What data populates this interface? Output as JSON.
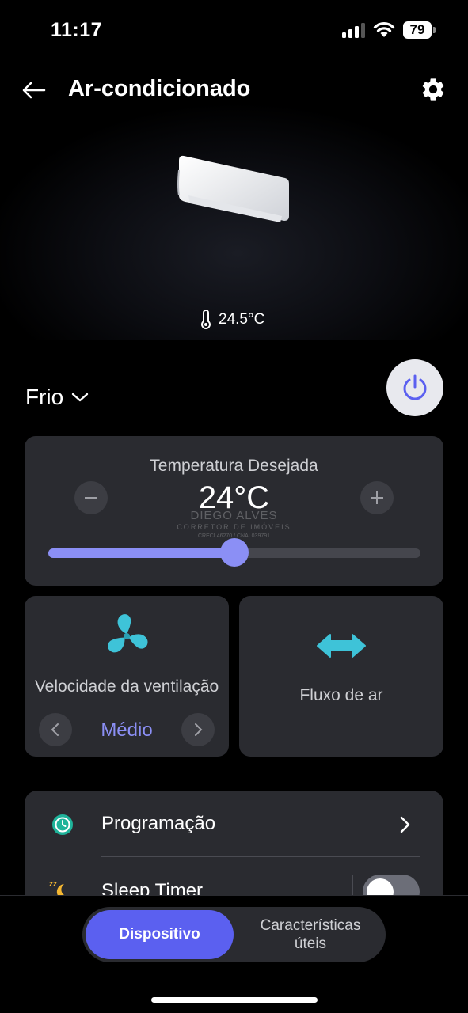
{
  "status_bar": {
    "time": "11:17",
    "battery": "79"
  },
  "header": {
    "title": "Ar-condicionado",
    "back_icon": "arrow-left-icon",
    "settings_icon": "gear-icon"
  },
  "hero": {
    "room_temperature": "24.5°C",
    "thermometer_icon": "thermometer-icon"
  },
  "mode": {
    "selected": "Frio",
    "dropdown_icon": "chevron-down-icon",
    "power_icon": "power-icon"
  },
  "temperature_card": {
    "label": "Temperatura Desejada",
    "value": "24°C",
    "slider_fraction": 0.5
  },
  "watermark": {
    "name": "DIEGO ALVES",
    "title": "CORRETOR DE IMÓVEIS",
    "registration": "CRECI 46270 / CNAI 039791"
  },
  "fan_card": {
    "label": "Velocidade da ventilação",
    "value": "Médio",
    "icon": "fan-icon"
  },
  "airflow_card": {
    "label": "Fluxo de ar",
    "icon": "horizontal-arrows-icon"
  },
  "list": {
    "items": [
      {
        "label": "Programação",
        "icon": "clock-icon"
      },
      {
        "label": "Sleep Timer",
        "icon": "sleep-moon-icon"
      }
    ]
  },
  "bottom_tabs": {
    "active": "Dispositivo",
    "inactive": "Características\núteis"
  },
  "colors": {
    "accent": "#8b8ff5",
    "tab_active": "#5b60f0",
    "card": "#2a2b30",
    "fan_icon": "#3ec3d8"
  }
}
